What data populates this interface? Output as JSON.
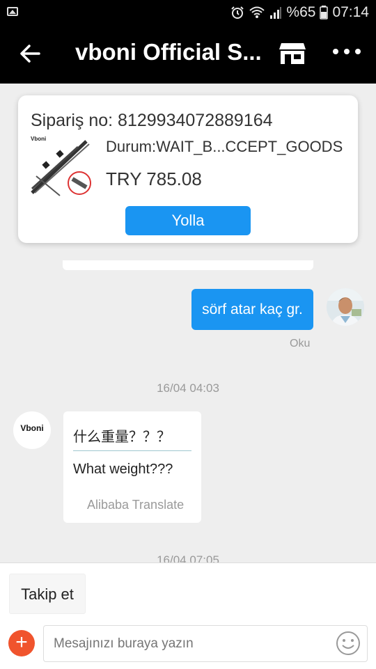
{
  "status_bar": {
    "battery_text": "%65",
    "time": "07:14",
    "icons": [
      "image-icon",
      "alarm-icon",
      "wifi-icon",
      "signal-icon",
      "battery-icon"
    ]
  },
  "header": {
    "title": "vboni Official S...",
    "icons": [
      "back-arrow-icon",
      "store-icon",
      "more-icon"
    ]
  },
  "order_card": {
    "order_number": "Sipariş no: 8129934072889164",
    "status": "Durum:WAIT_B...CCEPT_GOODS",
    "price": "TRY 785.08",
    "send_label": "Yolla",
    "product_brand": "Vboni"
  },
  "chat": {
    "messages": [
      {
        "from": "me",
        "text": "sörf atar kaç gr.",
        "status": "Oku"
      },
      {
        "type": "timestamp",
        "text": "16/04 04:03"
      },
      {
        "from": "shop",
        "original": "什么重量？？？",
        "translation": "What weight???",
        "translator": "Alibaba Translate",
        "avatar_text": "Vboni"
      },
      {
        "type": "timestamp",
        "text": "16/04 07:05"
      }
    ]
  },
  "bottom": {
    "follow_label": "Takip et",
    "input_placeholder": "Mesajınızı buraya yazın"
  },
  "colors": {
    "accent": "#1a95f2",
    "plus": "#f0542d",
    "header_bg": "#000000",
    "chat_bg": "#eeeeee"
  }
}
